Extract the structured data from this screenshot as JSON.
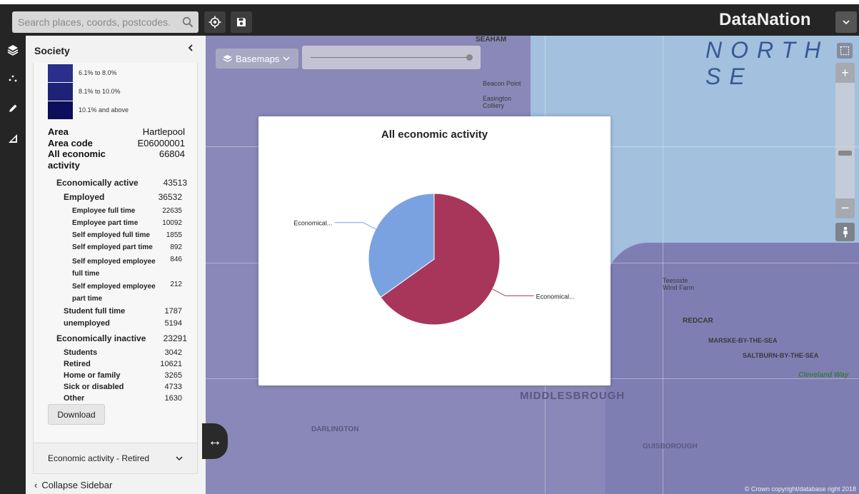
{
  "search": {
    "placeholder": "Search places, coords, postcodes..."
  },
  "brand": {
    "name": "DataNation"
  },
  "sidebar": {
    "title": "Society",
    "legend": [
      {
        "label": "6.1% to 8.0%",
        "color": "#2a2f8c"
      },
      {
        "label": "8.1% to 10.0%",
        "color": "#1f2378"
      },
      {
        "label": "10.1% and above",
        "color": "#0d0f5a"
      }
    ],
    "info": {
      "area_label": "Area",
      "area_value": "Hartlepool",
      "code_label": "Area code",
      "code_value": "E06000001",
      "total_label": "All economic activity",
      "total_value": "66804"
    },
    "stats": [
      {
        "name": "Economically active",
        "value": "43513"
      },
      {
        "name": "Employed",
        "value": "36532"
      },
      {
        "name": "Employee full time",
        "value": "22635"
      },
      {
        "name": "Employee part time",
        "value": "10092"
      },
      {
        "name": "Self employed full time",
        "value": "1855"
      },
      {
        "name": "Self employed part time",
        "value": "892"
      },
      {
        "name": "Self employed employee full time",
        "value": "846"
      },
      {
        "name": "Self employed employee part time",
        "value": "212"
      },
      {
        "name": "Student full time",
        "value": "1787"
      },
      {
        "name": "unemployed",
        "value": "5194"
      },
      {
        "name": "Economically inactive",
        "value": "23291"
      },
      {
        "name": "Students",
        "value": "3042"
      },
      {
        "name": "Retired",
        "value": "10621"
      },
      {
        "name": "Home or family",
        "value": "3265"
      },
      {
        "name": "Sick or disabled",
        "value": "4733"
      },
      {
        "name": "Other",
        "value": "1630"
      }
    ],
    "download_label": "Download",
    "accordion_label": "Economic activity - Retired",
    "collapse_label": "Collapse Sidebar"
  },
  "map": {
    "basemaps_label": "Basemaps",
    "sea_label": "NORTH SE",
    "copyright": "© Crown copyright/database right 2018",
    "places": {
      "seaham": "SEAHAM",
      "beacon_point": "Beacon Point",
      "easington": "Easington Colliery",
      "redcar": "REDCAR",
      "marske": "MARSKE-BY-THE-SEA",
      "saltburn": "SALTBURN-BY-THE-SEA",
      "middlesbrough": "MIDDLESBROUGH",
      "darlington": "DARLINGTON",
      "guisborough": "GUISBOROUGH",
      "teesside": "Teesside Wind Farm",
      "cleveland": "Cleveland Way"
    }
  },
  "chart_data": {
    "type": "pie",
    "title": "All economic activity",
    "categories": [
      "Economical...",
      "Economical..."
    ],
    "values": [
      43513,
      23291
    ],
    "colors": [
      "#a8355a",
      "#7ba2e0"
    ]
  }
}
